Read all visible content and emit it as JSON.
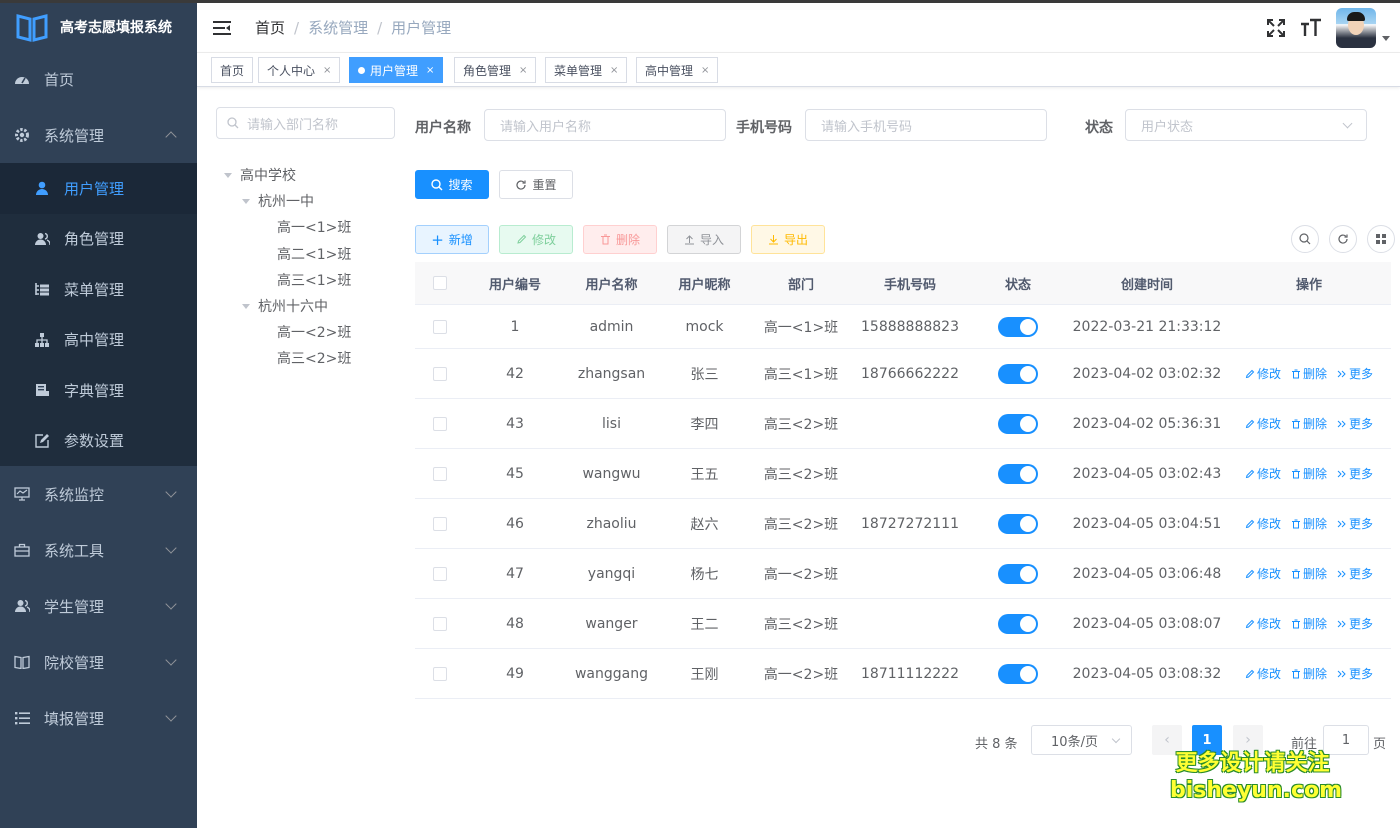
{
  "app": {
    "title": "高考志愿填报系统"
  },
  "sidebar": {
    "items": [
      {
        "label": "首页",
        "icon": "dashboard-icon"
      },
      {
        "label": "系统管理",
        "icon": "gear-icon",
        "expanded": true,
        "children": [
          {
            "label": "用户管理",
            "icon": "user-icon",
            "active": true
          },
          {
            "label": "角色管理",
            "icon": "users-icon"
          },
          {
            "label": "菜单管理",
            "icon": "tree-table-icon"
          },
          {
            "label": "高中管理",
            "icon": "org-tree-icon"
          },
          {
            "label": "字典管理",
            "icon": "dict-icon"
          },
          {
            "label": "参数设置",
            "icon": "edit-icon"
          }
        ]
      },
      {
        "label": "系统监控",
        "icon": "monitor-icon"
      },
      {
        "label": "系统工具",
        "icon": "toolbox-icon"
      },
      {
        "label": "学生管理",
        "icon": "students-icon"
      },
      {
        "label": "院校管理",
        "icon": "book-icon"
      },
      {
        "label": "填报管理",
        "icon": "list-icon"
      }
    ]
  },
  "breadcrumb": [
    "首页",
    "系统管理",
    "用户管理"
  ],
  "tags": [
    {
      "label": "首页",
      "closable": false
    },
    {
      "label": "个人中心",
      "closable": true
    },
    {
      "label": "用户管理",
      "closable": true,
      "active": true
    },
    {
      "label": "角色管理",
      "closable": true
    },
    {
      "label": "菜单管理",
      "closable": true
    },
    {
      "label": "高中管理",
      "closable": true
    }
  ],
  "close_glyph": "×",
  "dept_tree": {
    "search_placeholder": "请输入部门名称",
    "root": "高中学校",
    "schools": [
      {
        "name": "杭州一中",
        "classes": [
          "高一<1>班",
          "高二<1>班",
          "高三<1>班"
        ]
      },
      {
        "name": "杭州十六中",
        "classes": [
          "高一<2>班",
          "高三<2>班"
        ]
      }
    ]
  },
  "search_form": {
    "username_label": "用户名称",
    "username_placeholder": "请输入用户名称",
    "phone_label": "手机号码",
    "phone_placeholder": "请输入手机号码",
    "status_label": "状态",
    "status_placeholder": "用户状态",
    "search_button": "搜索",
    "reset_button": "重置"
  },
  "toolbar": {
    "add": "新增",
    "edit": "修改",
    "delete": "删除",
    "import": "导入",
    "export": "导出"
  },
  "table": {
    "columns": [
      "用户编号",
      "用户名称",
      "用户昵称",
      "部门",
      "手机号码",
      "状态",
      "创建时间",
      "操作"
    ],
    "rows": [
      {
        "id": "1",
        "username": "admin",
        "nickname": "mock",
        "dept": "高一<1>班",
        "phone": "15888888823",
        "enabled": true,
        "created": "2022-03-21 21:33:12",
        "ops": false
      },
      {
        "id": "42",
        "username": "zhangsan",
        "nickname": "张三",
        "dept": "高三<1>班",
        "phone": "18766662222",
        "enabled": true,
        "created": "2023-04-02 03:02:32",
        "ops": true
      },
      {
        "id": "43",
        "username": "lisi",
        "nickname": "李四",
        "dept": "高三<2>班",
        "phone": "",
        "enabled": true,
        "created": "2023-04-02 05:36:31",
        "ops": true
      },
      {
        "id": "45",
        "username": "wangwu",
        "nickname": "王五",
        "dept": "高三<2>班",
        "phone": "",
        "enabled": true,
        "created": "2023-04-05 03:02:43",
        "ops": true
      },
      {
        "id": "46",
        "username": "zhaoliu",
        "nickname": "赵六",
        "dept": "高三<2>班",
        "phone": "18727272111",
        "enabled": true,
        "created": "2023-04-05 03:04:51",
        "ops": true
      },
      {
        "id": "47",
        "username": "yangqi",
        "nickname": "杨七",
        "dept": "高一<2>班",
        "phone": "",
        "enabled": true,
        "created": "2023-04-05 03:06:48",
        "ops": true
      },
      {
        "id": "48",
        "username": "wanger",
        "nickname": "王二",
        "dept": "高三<2>班",
        "phone": "",
        "enabled": true,
        "created": "2023-04-05 03:08:07",
        "ops": true
      },
      {
        "id": "49",
        "username": "wanggang",
        "nickname": "王刚",
        "dept": "高一<2>班",
        "phone": "18711112222",
        "enabled": true,
        "created": "2023-04-05 03:08:32",
        "ops": true
      }
    ],
    "row_actions": {
      "edit": "修改",
      "delete": "删除",
      "more": "更多"
    }
  },
  "pagination": {
    "total_text": "共 8 条",
    "page_size": "10条/页",
    "current_page": "1",
    "goto_label": "前往",
    "goto_value": "1",
    "page_suffix": "页"
  },
  "watermark": {
    "line1": "更多设计请关注",
    "line2": "bisheyun.com"
  },
  "colors": {
    "sidebar_bg": "#304156",
    "sidebar_sub_bg": "#1f2d3d",
    "accent": "#1890ff",
    "active_menu_text": "#409eff"
  }
}
